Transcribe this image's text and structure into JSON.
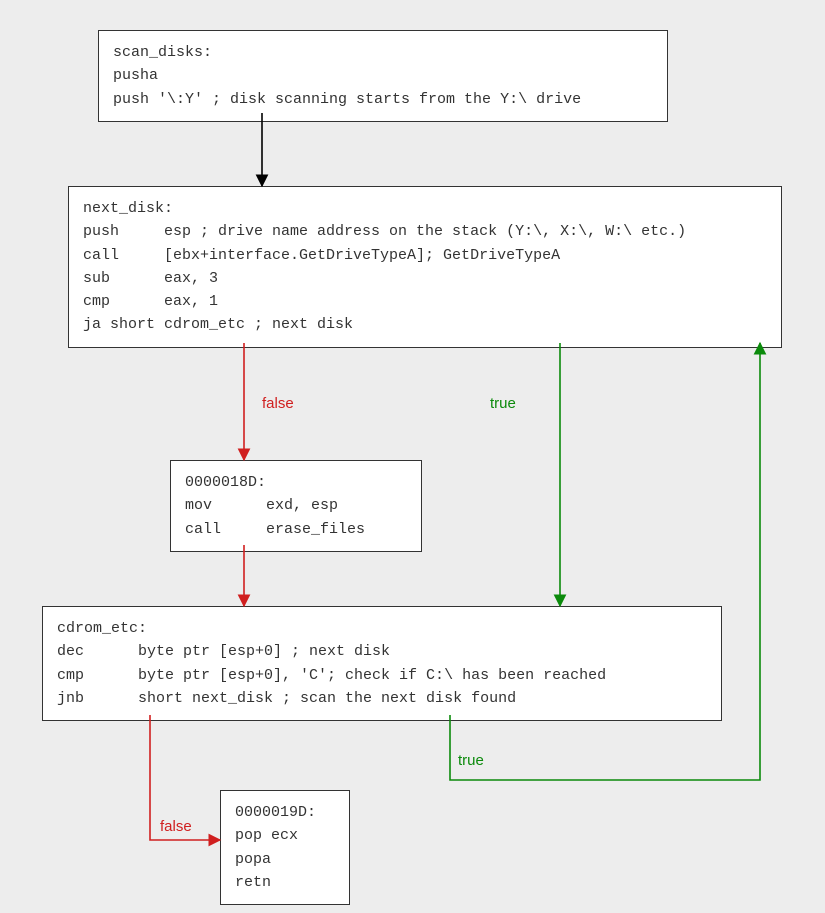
{
  "chart_data": {
    "type": "flowchart",
    "nodes": [
      {
        "id": "scan_disks",
        "text": "scan_disks:\npusha\npush '\\:Y' ; disk scanning starts from the Y:\\ drive"
      },
      {
        "id": "next_disk",
        "text": "next_disk:\npush     esp ; drive name address on the stack (Y:\\, X:\\, W:\\ etc.)\ncall     [ebx+interface.GetDriveTypeA]; GetDriveTypeA\nsub      eax, 3\ncmp      eax, 1\nja short cdrom_etc ; next disk"
      },
      {
        "id": "block_018d",
        "text": "0000018D:\nmov      exd, esp\ncall     erase_files"
      },
      {
        "id": "cdrom_etc",
        "text": "cdrom_etc:\ndec      byte ptr [esp+0] ; next disk\ncmp      byte ptr [esp+0], 'C'; check if C:\\ has been reached\njnb      short next_disk ; scan the next disk found"
      },
      {
        "id": "block_019d",
        "text": "0000019D:\npop ecx\npopa\nretn"
      }
    ],
    "edges": [
      {
        "from": "scan_disks",
        "to": "next_disk",
        "label": "",
        "color": "#000000"
      },
      {
        "from": "next_disk",
        "to": "block_018d",
        "label": "false",
        "color": "#D01F1F"
      },
      {
        "from": "next_disk",
        "to": "cdrom_etc",
        "label": "true",
        "color": "#0B8A0B"
      },
      {
        "from": "block_018d",
        "to": "cdrom_etc",
        "label": "",
        "color": "#D01F1F"
      },
      {
        "from": "cdrom_etc",
        "to": "block_019d",
        "label": "false",
        "color": "#D01F1F"
      },
      {
        "from": "cdrom_etc",
        "to": "next_disk",
        "label": "true",
        "color": "#0B8A0B"
      }
    ]
  },
  "boxes": {
    "scan_disks": "scan_disks:\npusha\npush '\\:Y' ; disk scanning starts from the Y:\\ drive",
    "next_disk": "next_disk:\npush     esp ; drive name address on the stack (Y:\\, X:\\, W:\\ etc.)\ncall     [ebx+interface.GetDriveTypeA]; GetDriveTypeA\nsub      eax, 3\ncmp      eax, 1\nja short cdrom_etc ; next disk",
    "block_018d": "0000018D:\nmov      exd, esp\ncall     erase_files",
    "cdrom_etc": "cdrom_etc:\ndec      byte ptr [esp+0] ; next disk\ncmp      byte ptr [esp+0], 'C'; check if C:\\ has been reached\njnb      short next_disk ; scan the next disk found",
    "block_019d": "0000019D:\npop ecx\npopa\nretn"
  },
  "labels": {
    "false": "false",
    "true": "true"
  }
}
